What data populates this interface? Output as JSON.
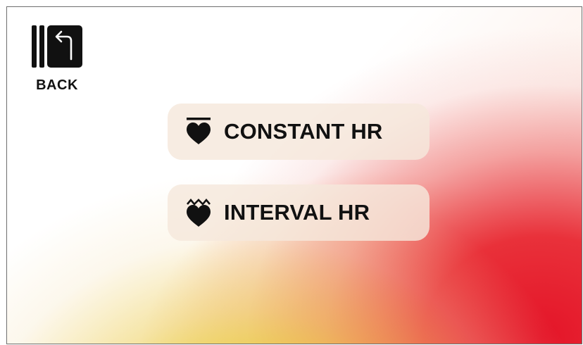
{
  "back": {
    "label": "BACK",
    "icon": "back-arrow-icon"
  },
  "menu": [
    {
      "label": "CONSTANT HR",
      "icon": "constant-heart-rate-icon"
    },
    {
      "label": "INTERVAL HR",
      "icon": "interval-heart-rate-icon"
    }
  ],
  "colors": {
    "text": "#111111",
    "button_bg": "#f5e8dc",
    "gradient_yellow": "#e6e128",
    "gradient_orange": "#ec7828",
    "gradient_red": "#e41428"
  }
}
